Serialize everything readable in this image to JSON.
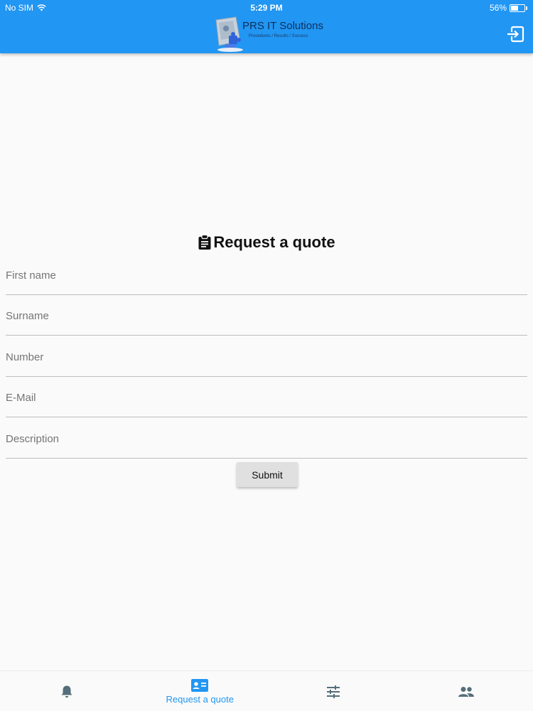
{
  "status_bar": {
    "carrier": "No SIM",
    "time": "5:29 PM",
    "battery": "56%",
    "battery_level": 0.56
  },
  "app_bar": {
    "logo_title": "PRS IT Solutions",
    "logo_subtitle": "Procedures / Results / Success",
    "logout_icon": "logout-icon",
    "background_color": "#2196f3"
  },
  "form": {
    "title": "Request a quote",
    "title_icon": "clipboard-icon",
    "fields": {
      "first_name": {
        "placeholder": "First name",
        "value": ""
      },
      "surname": {
        "placeholder": "Surname",
        "value": ""
      },
      "number": {
        "placeholder": "Number",
        "value": ""
      },
      "email": {
        "placeholder": "E-Mail",
        "value": ""
      },
      "description": {
        "placeholder": "Description",
        "value": ""
      }
    },
    "submit_label": "Submit"
  },
  "bottom_nav": {
    "active_color": "#2196f3",
    "inactive_color": "#546e7a",
    "items": [
      {
        "icon": "bell-icon",
        "label": "",
        "active": false
      },
      {
        "icon": "contact-card-icon",
        "label": "Request a quote",
        "active": true
      },
      {
        "icon": "sliders-icon",
        "label": "",
        "active": false
      },
      {
        "icon": "people-icon",
        "label": "",
        "active": false
      }
    ]
  }
}
